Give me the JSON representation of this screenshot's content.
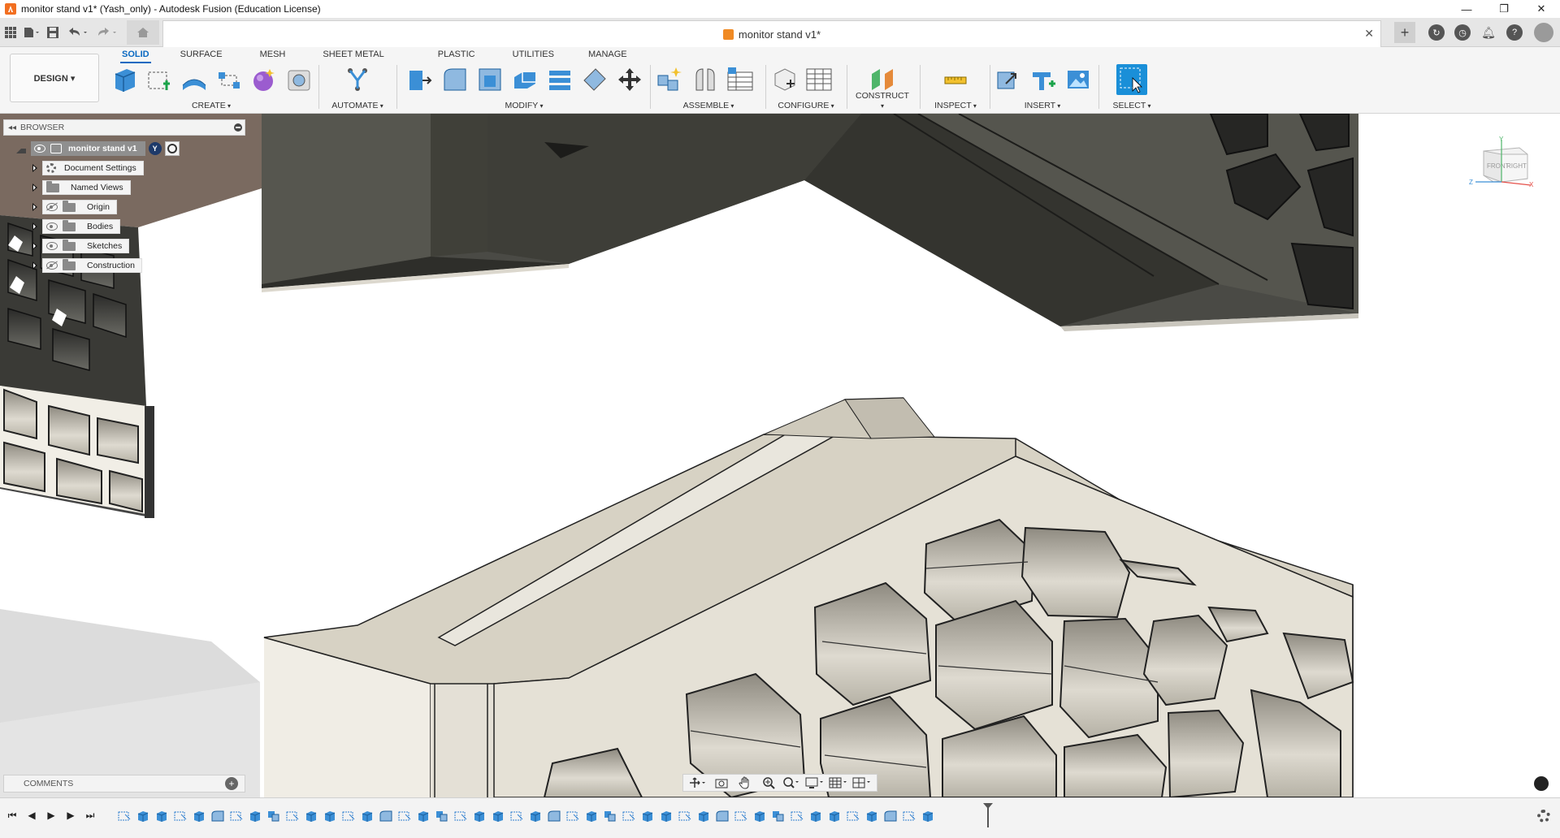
{
  "window": {
    "title": "monitor stand v1* (Yash_only) - Autodesk Fusion (Education License)",
    "buttons": [
      "—",
      "❐",
      "✕"
    ]
  },
  "document_tab": {
    "name": "monitor stand v1*",
    "close": "✕"
  },
  "toolbar": {
    "workspace_button": "DESIGN ▾",
    "tabs": [
      "SOLID",
      "SURFACE",
      "MESH",
      "SHEET METAL",
      "PLASTIC",
      "UTILITIES",
      "MANAGE"
    ],
    "active_tab": "SOLID",
    "groups": {
      "create": "CREATE",
      "automate": "AUTOMATE",
      "modify": "MODIFY",
      "assemble": "ASSEMBLE",
      "configure": "CONFIGURE",
      "construct": "CONSTRUCT",
      "inspect": "INSPECT",
      "insert": "INSERT",
      "select": "SELECT"
    }
  },
  "browser": {
    "title": "BROWSER",
    "root": "monitor stand v1",
    "root_badge": "Y",
    "items": [
      {
        "label": "Document Settings",
        "icon": "gear-icon"
      },
      {
        "label": "Named Views",
        "icon": "folder-icon"
      },
      {
        "label": "Origin",
        "icon": "folder-icon",
        "visibility": "hidden"
      },
      {
        "label": "Bodies",
        "icon": "folder-icon",
        "visibility": "visible"
      },
      {
        "label": "Sketches",
        "icon": "folder-icon",
        "visibility": "visible"
      },
      {
        "label": "Construction",
        "icon": "folder-icon",
        "visibility": "hidden"
      }
    ]
  },
  "viewcube": {
    "faces": [
      "FRONT",
      "RIGHT"
    ],
    "axes": [
      "Y",
      "Z",
      "X"
    ]
  },
  "comments": {
    "title": "COMMENTS",
    "add": "+"
  },
  "timeline": {
    "controls": [
      "⏮",
      "◀",
      "▶",
      "▶",
      "⏭"
    ],
    "feature_count": 44
  },
  "colors": {
    "accent": "#0a69c1",
    "part_light": "#d9d4c5",
    "part_dark": "#3c3c38",
    "select_blue": "#1a8fd8"
  }
}
